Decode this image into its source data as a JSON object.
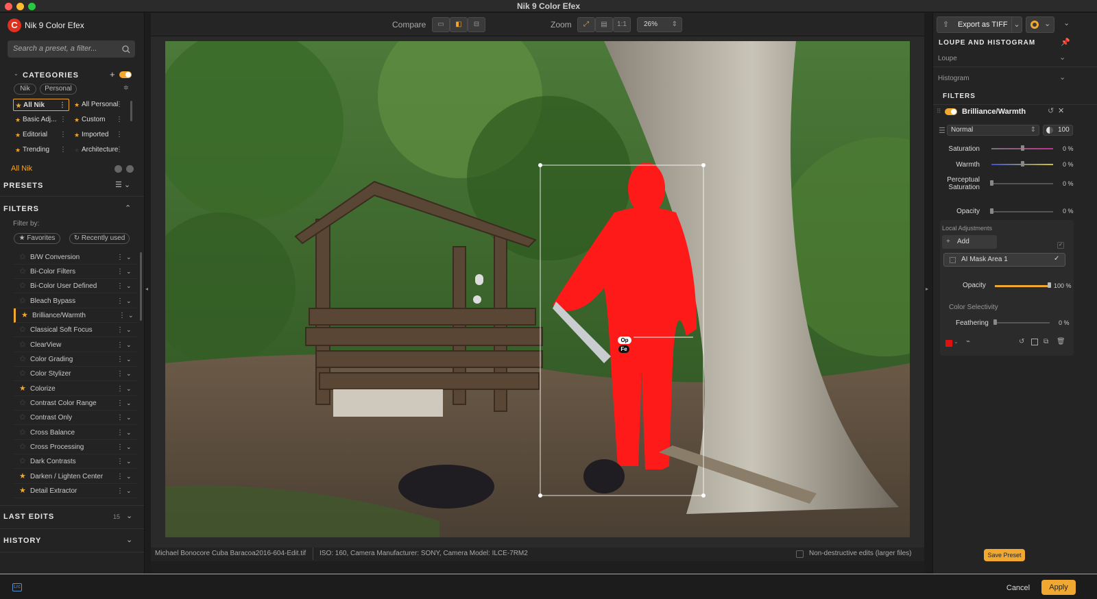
{
  "window": {
    "title": "Nik 9 Color Efex"
  },
  "app": {
    "name": "Nik 9 Color Efex"
  },
  "search": {
    "placeholder": "Search a preset, a filter..."
  },
  "categories": {
    "heading": "CATEGORIES",
    "chips": [
      "Nik",
      "Personal"
    ],
    "items": [
      {
        "label": "All Nik",
        "selected": true
      },
      {
        "label": "All Personal"
      },
      {
        "label": "Basic Adj..."
      },
      {
        "label": "Custom"
      },
      {
        "label": "Editorial"
      },
      {
        "label": "Imported"
      },
      {
        "label": "Trending"
      },
      {
        "label": "Architecture"
      }
    ],
    "current": "All Nik"
  },
  "presets": {
    "heading": "PRESETS"
  },
  "filters": {
    "heading": "FILTERS",
    "filter_by": "Filter by:",
    "favorites": "Favorites",
    "recently_used": "Recently used",
    "items": [
      {
        "name": "B/W Conversion",
        "fav": false
      },
      {
        "name": "Bi-Color Filters",
        "fav": false
      },
      {
        "name": "Bi-Color User Defined",
        "fav": false
      },
      {
        "name": "Bleach Bypass",
        "fav": false
      },
      {
        "name": "Brilliance/Warmth",
        "fav": true,
        "active": true
      },
      {
        "name": "Classical Soft Focus",
        "fav": false
      },
      {
        "name": "ClearView",
        "fav": false
      },
      {
        "name": "Color Grading",
        "fav": false
      },
      {
        "name": "Color Stylizer",
        "fav": false
      },
      {
        "name": "Colorize",
        "fav": true
      },
      {
        "name": "Contrast Color Range",
        "fav": false
      },
      {
        "name": "Contrast Only",
        "fav": false
      },
      {
        "name": "Cross Balance",
        "fav": false
      },
      {
        "name": "Cross Processing",
        "fav": false
      },
      {
        "name": "Dark Contrasts",
        "fav": false
      },
      {
        "name": "Darken / Lighten Center",
        "fav": true
      },
      {
        "name": "Detail Extractor",
        "fav": true
      }
    ]
  },
  "last_edits": {
    "heading": "LAST EDITS",
    "count": "15"
  },
  "history": {
    "heading": "HISTORY"
  },
  "toolbar": {
    "compare_label": "Compare",
    "zoom_label": "Zoom",
    "zoom_one": "1:1",
    "zoom_value": "26%"
  },
  "status": {
    "filename": "Michael Bonocore Cuba Baracoa2016-604-Edit.tif",
    "meta": "ISO: 160, Camera Manufacturer: SONY, Camera Model: ILCE-7RM2",
    "nondestructive": "Non-destructive edits (larger files)"
  },
  "mask_handles": {
    "op": "Op",
    "fe": "Fe"
  },
  "export": {
    "label": "Export as TIFF"
  },
  "loupe": {
    "heading": "LOUPE AND HISTOGRAM",
    "loupe": "Loupe",
    "histogram": "Histogram"
  },
  "filter_panel": {
    "heading": "FILTERS",
    "name": "Brilliance/Warmth",
    "blend_mode": "Normal",
    "opacity_value": "100",
    "sliders": [
      {
        "label": "Saturation",
        "value": "0 %"
      },
      {
        "label": "Warmth",
        "value": "0 %"
      },
      {
        "label": "Perceptual Saturation",
        "value": "0 %"
      },
      {
        "label": "Opacity",
        "value": "0 %"
      }
    ],
    "local_adjustments": "Local Adjustments",
    "add": "Add",
    "mask_name": "AI Mask Area 1",
    "mask_opacity_label": "Opacity",
    "mask_opacity_value": "100 %",
    "color_selectivity": "Color Selectivity",
    "feathering_label": "Feathering",
    "feathering_value": "0 %"
  },
  "buttons": {
    "save_preset": "Save Preset",
    "cancel": "Cancel",
    "apply": "Apply"
  },
  "colors": {
    "accent": "#f0a830",
    "mask": "#ff1a1a",
    "logo": "#e0301e"
  }
}
